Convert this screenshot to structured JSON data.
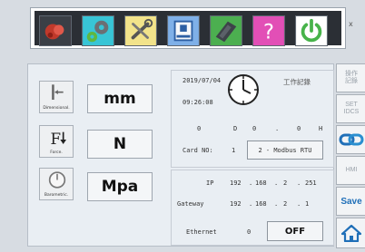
{
  "toolbar": {
    "buttons": [
      {
        "icon": "logo-icon",
        "color": "#c0392b"
      },
      {
        "icon": "gear-icon",
        "color": "#5fb83f"
      },
      {
        "icon": "tools-icon",
        "color": "#f2e38a"
      },
      {
        "icon": "panel-icon",
        "color": "#5b8ed6"
      },
      {
        "icon": "card-icon",
        "color": "#4caf50"
      },
      {
        "icon": "help-icon",
        "color": "#e24fb6"
      },
      {
        "icon": "power-icon",
        "color": "#47b34a"
      }
    ],
    "close_glyph": "x"
  },
  "units": [
    {
      "caption": "Dimensional.",
      "label": "mm"
    },
    {
      "caption": "Force.",
      "label": "N"
    },
    {
      "caption": "Barometric.",
      "label": "Mpa"
    }
  ],
  "status": {
    "date": "2019/07/04",
    "time": "09:26:08",
    "work_record": "工作記錄",
    "counter": {
      "d_value": "0",
      "d_label": "D",
      "mid_value": "0",
      "sep": ".",
      "h_value": "0",
      "h_label": "H"
    }
  },
  "card": {
    "label": "Card NO:",
    "number": "1",
    "mode": "2 - Modbus RTU"
  },
  "network": {
    "ip_label": "IP",
    "ip": [
      "192",
      "168",
      "2",
      "251"
    ],
    "gateway_label": "Gateway",
    "gateway": [
      "192",
      "168",
      "2",
      "1"
    ],
    "dot": ".",
    "ethernet_label": "Ethernet",
    "ethernet_value": "0",
    "off_label": "OFF"
  },
  "side": {
    "record_line1": "操作",
    "record_line2": "記錄",
    "set_line1": "SET",
    "set_line2": "IDCS",
    "hmi_label": "HMI",
    "save_label": "Save"
  },
  "colors": {
    "accent": "#1f6fb8",
    "toolbar_bg": "#2b2f35"
  }
}
